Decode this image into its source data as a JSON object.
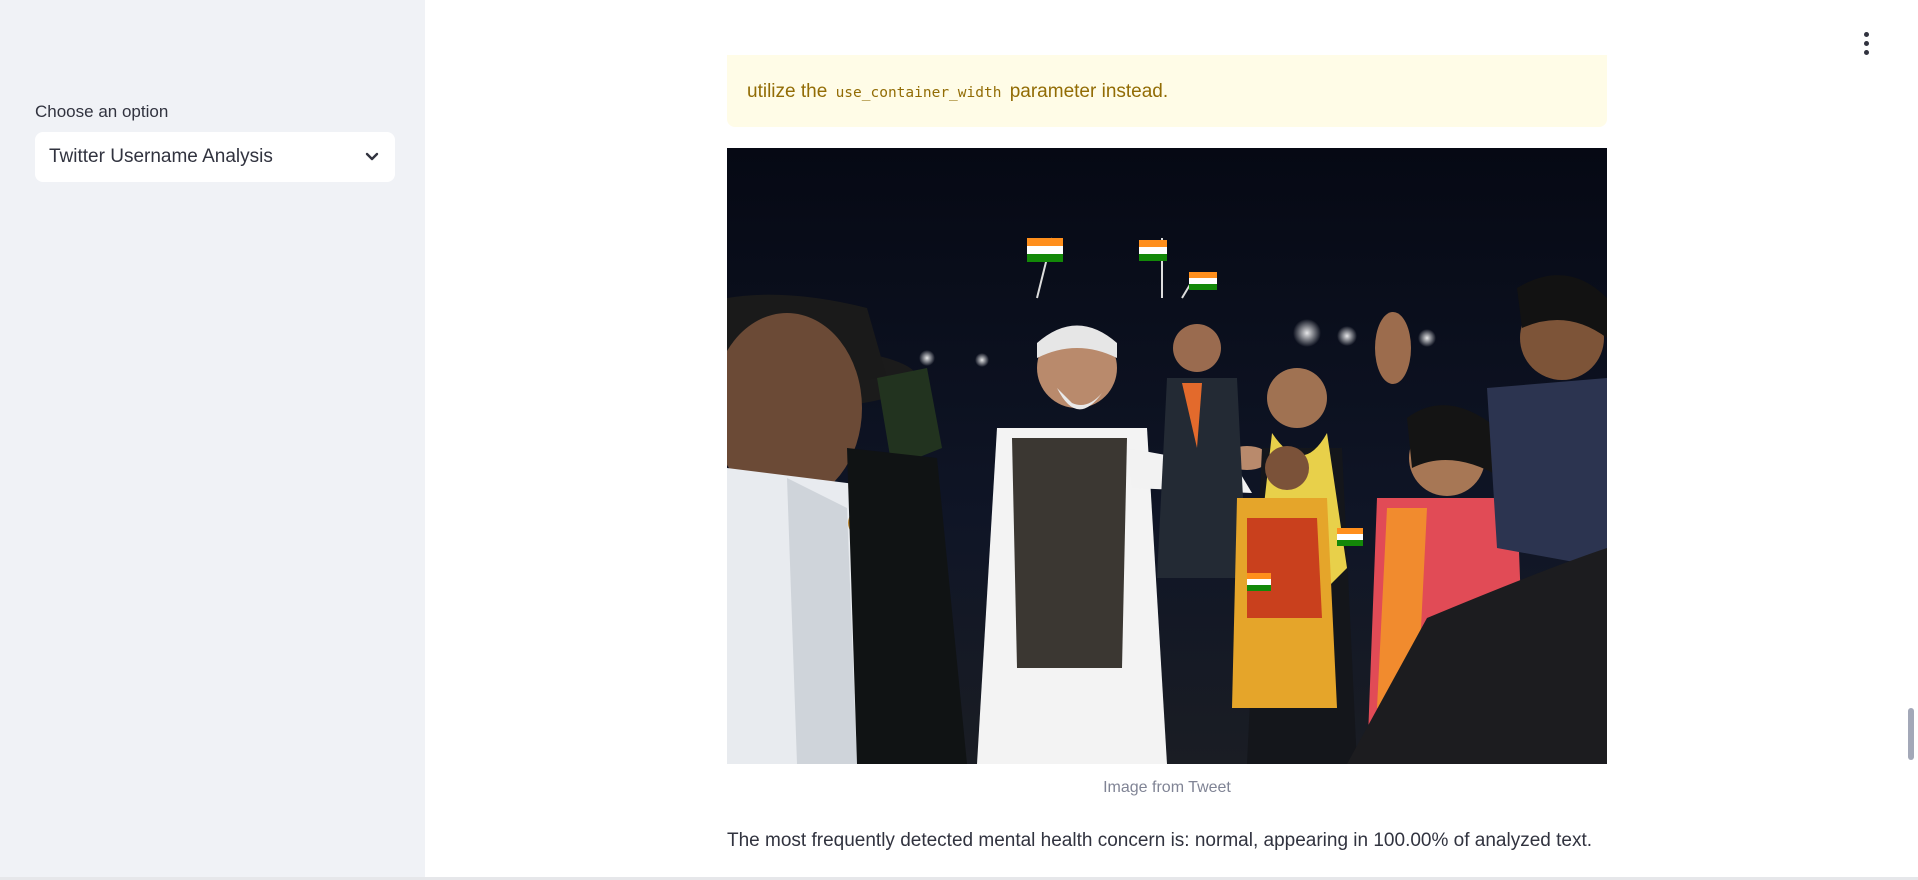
{
  "sidebar": {
    "select_label": "Choose an option",
    "select_value": "Twitter Username Analysis"
  },
  "main": {
    "warning": {
      "prefix": "utilize the",
      "code": "use_container_width",
      "suffix": "parameter instead."
    },
    "image_caption": "Image from Tweet",
    "result_text": "The most frequently detected mental health concern is: normal, appearing in 100.00% of analyzed text."
  },
  "icons": {
    "select_chevron": "chevron-down-icon",
    "main_menu": "kebab-menu-icon"
  },
  "colors": {
    "sidebar_bg": "#f0f2f6",
    "warning_bg": "#fffce7",
    "warning_text": "#926c05",
    "caption": "#808495",
    "body_text": "#31333f"
  }
}
